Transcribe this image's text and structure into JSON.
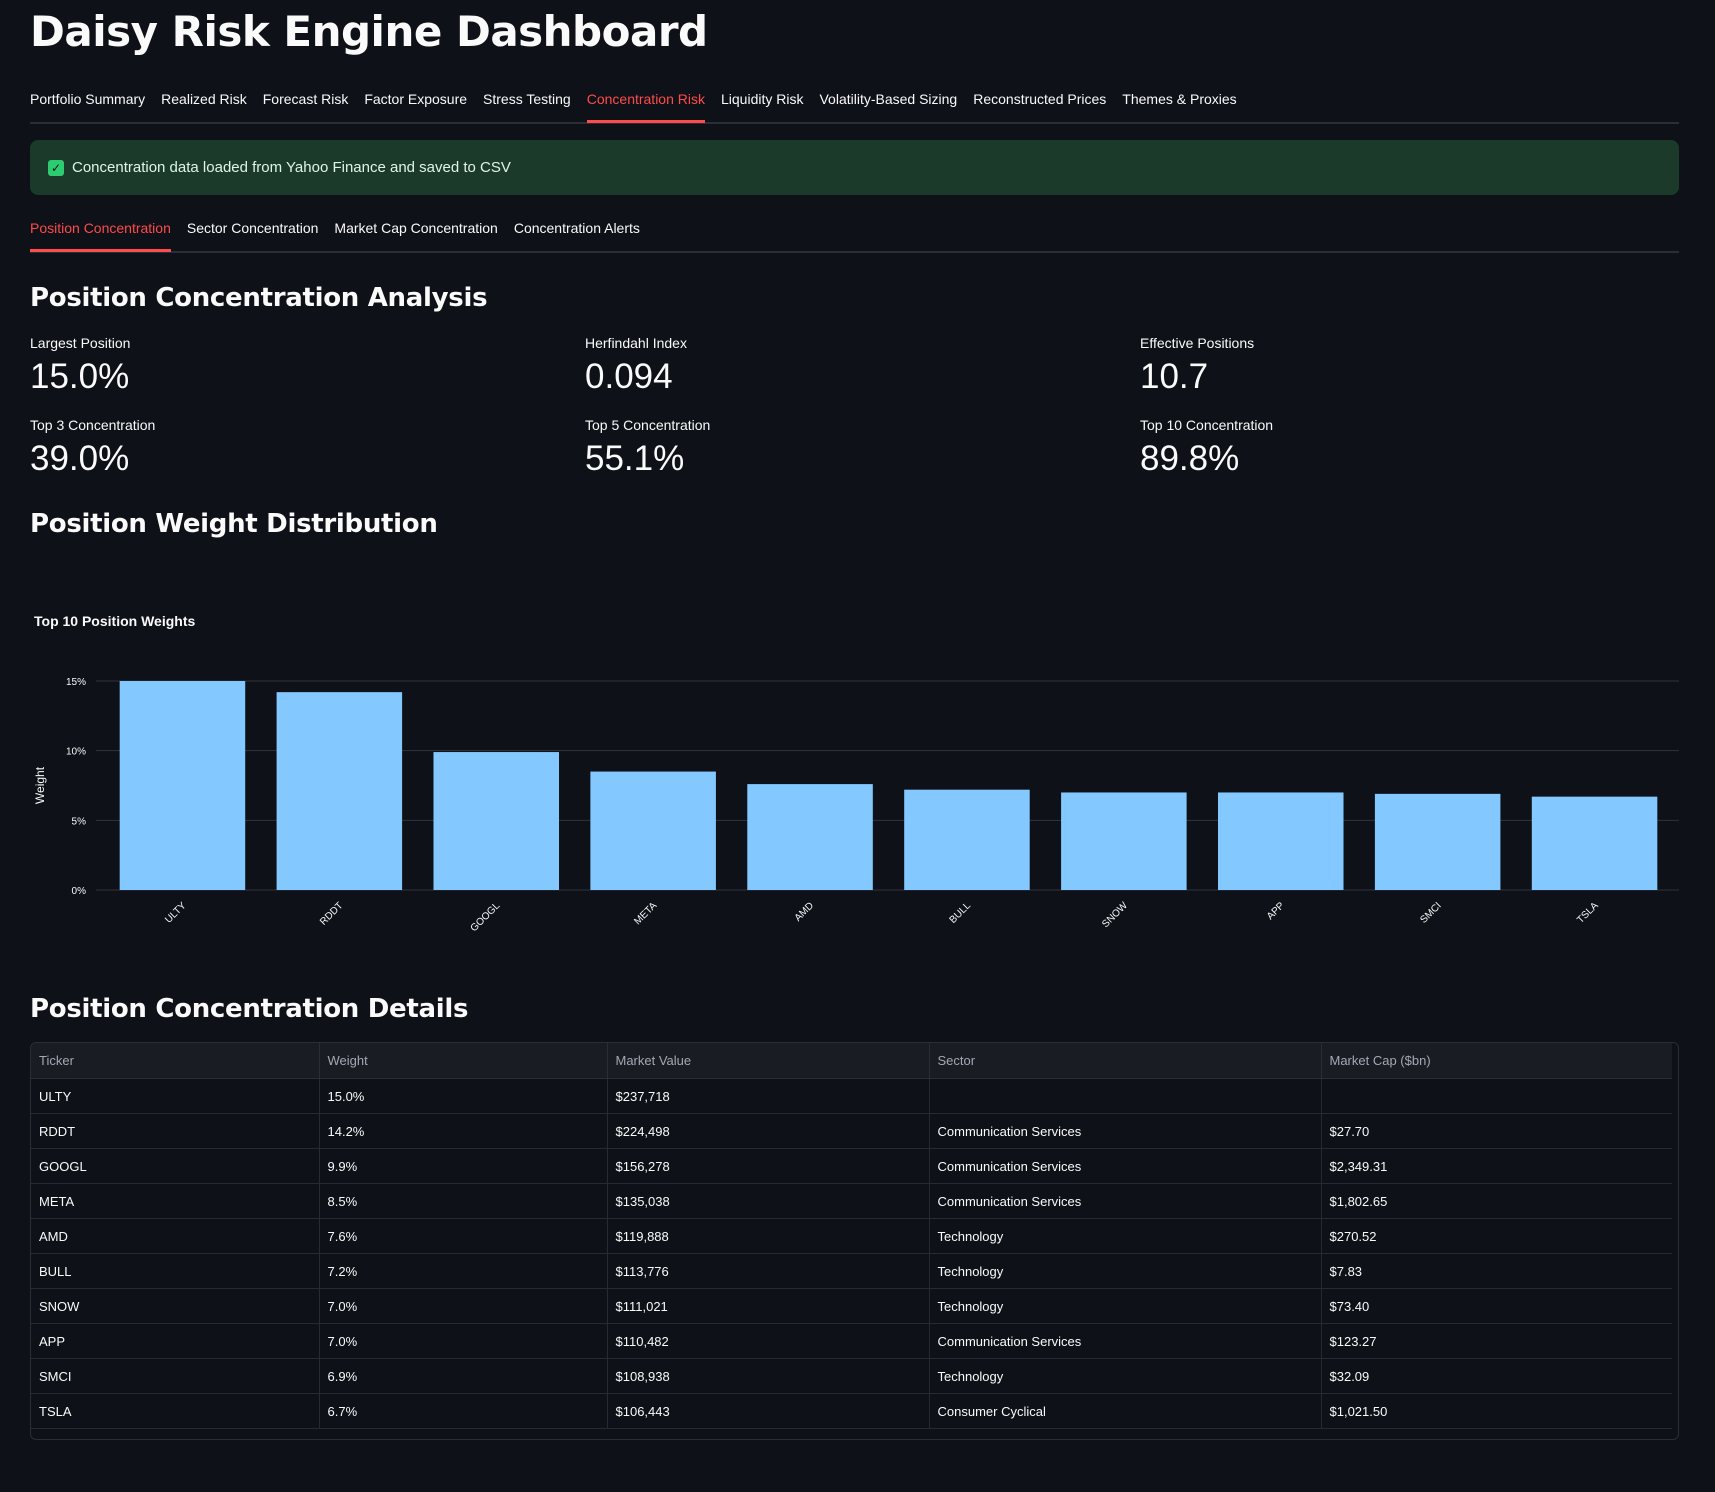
{
  "app": {
    "title": "Daisy Risk Engine Dashboard"
  },
  "tabs": [
    {
      "label": "Portfolio Summary",
      "active": false
    },
    {
      "label": "Realized Risk",
      "active": false
    },
    {
      "label": "Forecast Risk",
      "active": false
    },
    {
      "label": "Factor Exposure",
      "active": false
    },
    {
      "label": "Stress Testing",
      "active": false
    },
    {
      "label": "Concentration Risk",
      "active": true
    },
    {
      "label": "Liquidity Risk",
      "active": false
    },
    {
      "label": "Volatility-Based Sizing",
      "active": false
    },
    {
      "label": "Reconstructed Prices",
      "active": false
    },
    {
      "label": "Themes & Proxies",
      "active": false
    }
  ],
  "alert": {
    "icon": "check-icon",
    "text": "Concentration data loaded from Yahoo Finance and saved to CSV"
  },
  "subtabs": [
    {
      "label": "Position Concentration",
      "active": true
    },
    {
      "label": "Sector Concentration",
      "active": false
    },
    {
      "label": "Market Cap Concentration",
      "active": false
    },
    {
      "label": "Concentration Alerts",
      "active": false
    }
  ],
  "analysis": {
    "title": "Position Concentration Analysis",
    "metrics": [
      {
        "label": "Largest Position",
        "value": "15.0%"
      },
      {
        "label": "Herfindahl Index",
        "value": "0.094"
      },
      {
        "label": "Effective Positions",
        "value": "10.7"
      },
      {
        "label": "Top 3 Concentration",
        "value": "39.0%"
      },
      {
        "label": "Top 5 Concentration",
        "value": "55.1%"
      },
      {
        "label": "Top 10 Concentration",
        "value": "89.8%"
      }
    ]
  },
  "distribution": {
    "title": "Position Weight Distribution"
  },
  "chart_data": {
    "type": "bar",
    "title": "Top 10 Position Weights",
    "xlabel": "",
    "ylabel": "Weight",
    "categories": [
      "ULTY",
      "RDDT",
      "GOOGL",
      "META",
      "AMD",
      "BULL",
      "SNOW",
      "APP",
      "SMCI",
      "TSLA"
    ],
    "values": [
      15.0,
      14.2,
      9.9,
      8.5,
      7.6,
      7.2,
      7.0,
      7.0,
      6.9,
      6.7
    ],
    "yticks": [
      "0%",
      "5%",
      "10%",
      "15%"
    ],
    "ylim": [
      0,
      15
    ],
    "grid": true,
    "color": "#83c9ff"
  },
  "details": {
    "title": "Position Concentration Details",
    "columns": [
      "Ticker",
      "Weight",
      "Market Value",
      "Sector",
      "Market Cap ($bn)"
    ],
    "rows": [
      [
        "ULTY",
        "15.0%",
        "$237,718",
        "",
        ""
      ],
      [
        "RDDT",
        "14.2%",
        "$224,498",
        "Communication Services",
        "$27.70"
      ],
      [
        "GOOGL",
        "9.9%",
        "$156,278",
        "Communication Services",
        "$2,349.31"
      ],
      [
        "META",
        "8.5%",
        "$135,038",
        "Communication Services",
        "$1,802.65"
      ],
      [
        "AMD",
        "7.6%",
        "$119,888",
        "Technology",
        "$270.52"
      ],
      [
        "BULL",
        "7.2%",
        "$113,776",
        "Technology",
        "$7.83"
      ],
      [
        "SNOW",
        "7.0%",
        "$111,021",
        "Technology",
        "$73.40"
      ],
      [
        "APP",
        "7.0%",
        "$110,482",
        "Communication Services",
        "$123.27"
      ],
      [
        "SMCI",
        "6.9%",
        "$108,938",
        "Technology",
        "$32.09"
      ],
      [
        "TSLA",
        "6.7%",
        "$106,443",
        "Consumer Cyclical",
        "$1,021.50"
      ]
    ]
  }
}
